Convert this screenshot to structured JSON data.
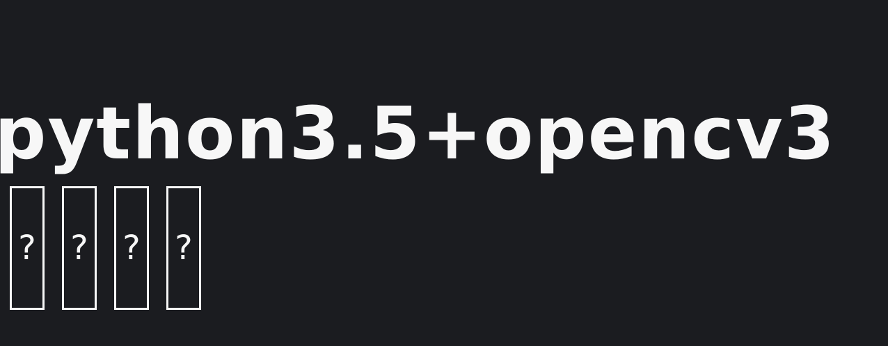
{
  "title": {
    "text": "python3.5+opencv3",
    "missing_glyphs": [
      "?",
      "?",
      "?",
      "?"
    ]
  },
  "colors": {
    "background": "#1b1c20",
    "foreground": "#f7f7f7"
  }
}
